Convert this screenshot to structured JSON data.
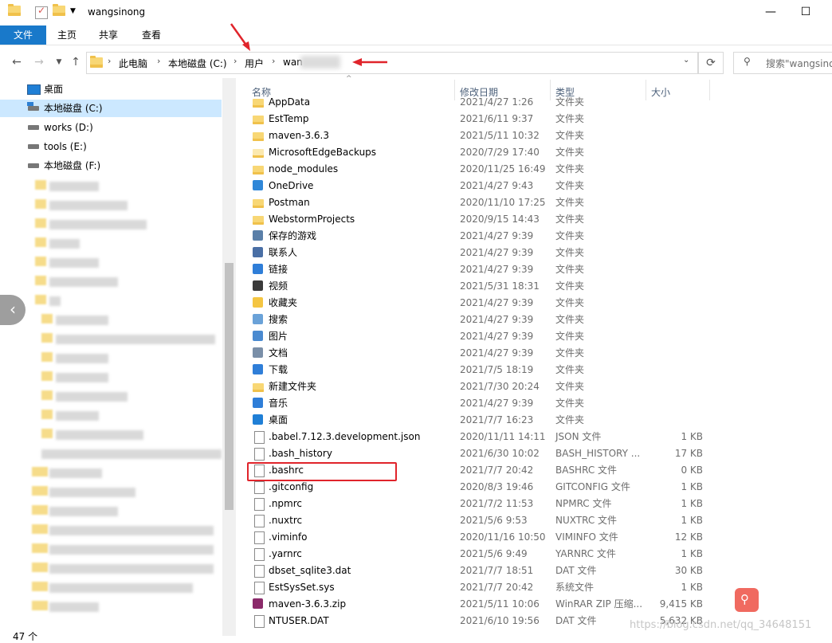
{
  "window": {
    "title": "wangsinong",
    "minimize": "—",
    "maximize": "☐"
  },
  "ribbon": {
    "tabs": [
      "文件",
      "主页",
      "共享",
      "查看"
    ]
  },
  "address": {
    "crumbs": [
      "此电脑",
      "本地磁盘 (C:)",
      "用户",
      "wan"
    ],
    "search_placeholder": "搜索\"wangsinong"
  },
  "nav": {
    "items": [
      {
        "label": "桌面",
        "icon": "desktop-icon"
      },
      {
        "label": "本地磁盘 (C:)",
        "icon": "drive-icon",
        "selected": true
      },
      {
        "label": "works (D:)",
        "icon": "drive-icon"
      },
      {
        "label": "tools (E:)",
        "icon": "drive-icon"
      },
      {
        "label": "本地磁盘 (F:)",
        "icon": "drive-icon"
      }
    ]
  },
  "columns": {
    "name": "名称",
    "date": "修改日期",
    "type": "类型",
    "size": "大小"
  },
  "files": [
    {
      "name": "AppData",
      "date": "2021/4/27 1:26",
      "type": "文件夹",
      "size": "",
      "icon": "folder"
    },
    {
      "name": "EstTemp",
      "date": "2021/6/11 9:37",
      "type": "文件夹",
      "size": "",
      "icon": "folder"
    },
    {
      "name": "maven-3.6.3",
      "date": "2021/5/11 10:32",
      "type": "文件夹",
      "size": "",
      "icon": "folder"
    },
    {
      "name": "MicrosoftEdgeBackups",
      "date": "2020/7/29 17:40",
      "type": "文件夹",
      "size": "",
      "icon": "folder-light"
    },
    {
      "name": "node_modules",
      "date": "2020/11/25 16:49",
      "type": "文件夹",
      "size": "",
      "icon": "folder"
    },
    {
      "name": "OneDrive",
      "date": "2021/4/27 9:43",
      "type": "文件夹",
      "size": "",
      "icon": "onedrive"
    },
    {
      "name": "Postman",
      "date": "2020/11/10 17:25",
      "type": "文件夹",
      "size": "",
      "icon": "folder"
    },
    {
      "name": "WebstormProjects",
      "date": "2020/9/15 14:43",
      "type": "文件夹",
      "size": "",
      "icon": "folder"
    },
    {
      "name": "保存的游戏",
      "date": "2021/4/27 9:39",
      "type": "文件夹",
      "size": "",
      "icon": "games"
    },
    {
      "name": "联系人",
      "date": "2021/4/27 9:39",
      "type": "文件夹",
      "size": "",
      "icon": "contacts"
    },
    {
      "name": "链接",
      "date": "2021/4/27 9:39",
      "type": "文件夹",
      "size": "",
      "icon": "links"
    },
    {
      "name": "视频",
      "date": "2021/5/31 18:31",
      "type": "文件夹",
      "size": "",
      "icon": "videos"
    },
    {
      "name": "收藏夹",
      "date": "2021/4/27 9:39",
      "type": "文件夹",
      "size": "",
      "icon": "favorites"
    },
    {
      "name": "搜索",
      "date": "2021/4/27 9:39",
      "type": "文件夹",
      "size": "",
      "icon": "searches"
    },
    {
      "name": "图片",
      "date": "2021/4/27 9:39",
      "type": "文件夹",
      "size": "",
      "icon": "pictures"
    },
    {
      "name": "文档",
      "date": "2021/4/27 9:39",
      "type": "文件夹",
      "size": "",
      "icon": "documents"
    },
    {
      "name": "下载",
      "date": "2021/7/5 18:19",
      "type": "文件夹",
      "size": "",
      "icon": "downloads"
    },
    {
      "name": "新建文件夹",
      "date": "2021/7/30 20:24",
      "type": "文件夹",
      "size": "",
      "icon": "folder"
    },
    {
      "name": "音乐",
      "date": "2021/4/27 9:39",
      "type": "文件夹",
      "size": "",
      "icon": "music"
    },
    {
      "name": "桌面",
      "date": "2021/7/7 16:23",
      "type": "文件夹",
      "size": "",
      "icon": "desktop"
    },
    {
      "name": ".babel.7.12.3.development.json",
      "date": "2020/11/11 14:11",
      "type": "JSON 文件",
      "size": "1 KB",
      "icon": "file"
    },
    {
      "name": ".bash_history",
      "date": "2021/6/30 10:02",
      "type": "BASH_HISTORY ...",
      "size": "17 KB",
      "icon": "file"
    },
    {
      "name": ".bashrc",
      "date": "2021/7/7 20:42",
      "type": "BASHRC 文件",
      "size": "0 KB",
      "icon": "file"
    },
    {
      "name": ".gitconfig",
      "date": "2020/8/3 19:46",
      "type": "GITCONFIG 文件",
      "size": "1 KB",
      "icon": "file"
    },
    {
      "name": ".npmrc",
      "date": "2021/7/2 11:53",
      "type": "NPMRC 文件",
      "size": "1 KB",
      "icon": "file"
    },
    {
      "name": ".nuxtrc",
      "date": "2021/5/6 9:53",
      "type": "NUXTRC 文件",
      "size": "1 KB",
      "icon": "file"
    },
    {
      "name": ".viminfo",
      "date": "2020/11/16 10:50",
      "type": "VIMINFO 文件",
      "size": "12 KB",
      "icon": "file"
    },
    {
      "name": ".yarnrc",
      "date": "2021/5/6 9:49",
      "type": "YARNRC 文件",
      "size": "1 KB",
      "icon": "file"
    },
    {
      "name": "dbset_sqlite3.dat",
      "date": "2021/7/7 18:51",
      "type": "DAT 文件",
      "size": "30 KB",
      "icon": "file"
    },
    {
      "name": "EstSysSet.sys",
      "date": "2021/7/7 20:42",
      "type": "系统文件",
      "size": "1 KB",
      "icon": "file"
    },
    {
      "name": "maven-3.6.3.zip",
      "date": "2021/5/11 10:06",
      "type": "WinRAR ZIP 压缩...",
      "size": "9,415 KB",
      "icon": "winrar"
    },
    {
      "name": "NTUSER.DAT",
      "date": "2021/6/10 19:56",
      "type": "DAT 文件",
      "size": "5,632 KB",
      "icon": "file"
    }
  ],
  "status": {
    "count": "47 个"
  },
  "watermark": "https://blog.csdn.net/qq_34648151",
  "colors": {
    "accent": "#1979ca",
    "highlight": "#e0242b",
    "folder": "#f8d775"
  }
}
